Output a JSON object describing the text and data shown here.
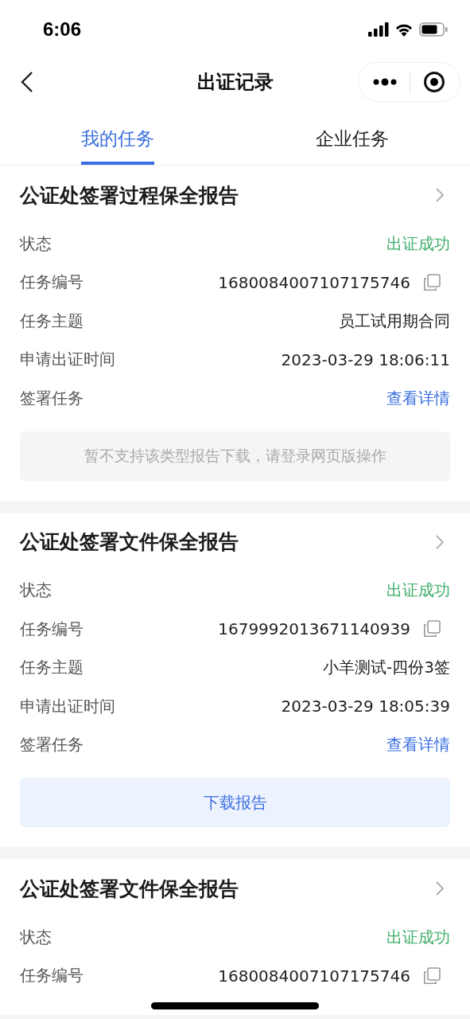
{
  "status_bar": {
    "time": "6:06"
  },
  "nav": {
    "title": "出证记录"
  },
  "tabs": [
    {
      "label": "我的任务",
      "selected": true
    },
    {
      "label": "企业任务",
      "selected": false
    }
  ],
  "records": [
    {
      "title": "公证处签署过程保全报告",
      "fields": [
        {
          "kind": "status",
          "label": "状态",
          "value": "出证成功"
        },
        {
          "kind": "copy",
          "label": "任务编号",
          "value": "1680084007107175746"
        },
        {
          "kind": "text",
          "label": "任务主题",
          "value": "员工试用期合同"
        },
        {
          "kind": "text",
          "label": "申请出证时间",
          "value": "2023-03-29 18:06:11"
        },
        {
          "kind": "link",
          "label": "签署任务",
          "value": "查看详情"
        }
      ],
      "footer": {
        "kind": "notice",
        "text": "暂不支持该类型报告下载，请登录网页版操作"
      }
    },
    {
      "title": "公证处签署文件保全报告",
      "fields": [
        {
          "kind": "status",
          "label": "状态",
          "value": "出证成功"
        },
        {
          "kind": "copy",
          "label": "任务编号",
          "value": "1679992013671140939"
        },
        {
          "kind": "text",
          "label": "任务主题",
          "value": "小羊测试-四份3签"
        },
        {
          "kind": "text",
          "label": "申请出证时间",
          "value": "2023-03-29 18:05:39"
        },
        {
          "kind": "link",
          "label": "签署任务",
          "value": "查看详情"
        }
      ],
      "footer": {
        "kind": "button",
        "text": "下载报告"
      }
    },
    {
      "title": "公证处签署文件保全报告",
      "fields": [
        {
          "kind": "status",
          "label": "状态",
          "value": "出证成功"
        },
        {
          "kind": "copy",
          "label": "任务编号",
          "value": "1680084007107175746"
        }
      ]
    }
  ]
}
